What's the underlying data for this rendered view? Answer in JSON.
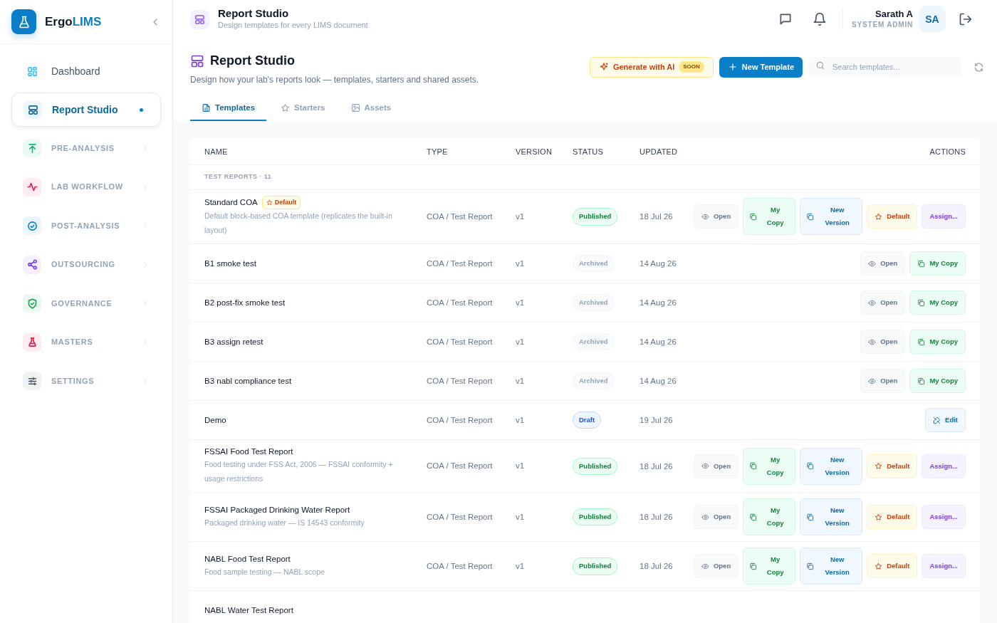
{
  "brand": {
    "prefix": "Ergo",
    "suffix": "LIMS"
  },
  "sidebar": {
    "items": [
      {
        "label": "Dashboard",
        "kind": "link",
        "selected": false
      },
      {
        "label": "Report Studio",
        "kind": "link",
        "selected": true
      },
      {
        "label": "PRE-ANALYSIS",
        "kind": "section",
        "selected": false,
        "color": "#10b981"
      },
      {
        "label": "LAB WORKFLOW",
        "kind": "section",
        "selected": false,
        "color": "#e11d48"
      },
      {
        "label": "POST-ANALYSIS",
        "kind": "section",
        "selected": false,
        "color": "#0284c7"
      },
      {
        "label": "OUTSOURCING",
        "kind": "section",
        "selected": false,
        "color": "#7c3aed"
      },
      {
        "label": "GOVERNANCE",
        "kind": "section",
        "selected": false,
        "color": "#16a34a"
      },
      {
        "label": "MASTERS",
        "kind": "section",
        "selected": false,
        "color": "#e11d48"
      },
      {
        "label": "SETTINGS",
        "kind": "section",
        "selected": false,
        "color": "#475569"
      }
    ]
  },
  "topbar": {
    "title": "Report Studio",
    "subtitle": "Design templates for every LIMS document",
    "user": {
      "name": "Sarath A",
      "role": "SYSTEM ADMIN",
      "initials": "SA"
    }
  },
  "page": {
    "title": "Report Studio",
    "description": "Design how your lab's reports look — templates, starters and shared assets.",
    "ai_button": {
      "label": "Generate with AI",
      "badge": "SOON"
    },
    "new_button": "New Template",
    "search": {
      "placeholder": "Search templates..."
    }
  },
  "tabs": [
    {
      "label": "Templates",
      "selected": true
    },
    {
      "label": "Starters",
      "selected": false
    },
    {
      "label": "Assets",
      "selected": false
    }
  ],
  "table": {
    "columns": [
      "NAME",
      "TYPE",
      "VERSION",
      "STATUS",
      "UPDATED",
      "ACTIONS"
    ],
    "group": "TEST REPORTS · 11",
    "rows": [
      {
        "name": "Standard COA",
        "badge": "Default",
        "description": "Default block-based COA template (replicates the built-in layout)",
        "type": "COA / Test Report",
        "version": "v1",
        "status": {
          "label": "Published",
          "kind": "published"
        },
        "updated": "18 Jul 26",
        "actions": [
          {
            "label": "Open",
            "kind": "open"
          },
          {
            "label": "My Copy",
            "kind": "copy"
          },
          {
            "label": "New Version",
            "kind": "version"
          },
          {
            "label": "Default",
            "kind": "default"
          },
          {
            "label": "Assign...",
            "kind": "assign"
          }
        ]
      },
      {
        "name": "B1 smoke test",
        "type": "COA / Test Report",
        "version": "v1",
        "status": {
          "label": "Archived",
          "kind": "archived"
        },
        "updated": "14 Aug 26",
        "actions": [
          {
            "label": "Open",
            "kind": "open"
          },
          {
            "label": "My Copy",
            "kind": "copy"
          }
        ]
      },
      {
        "name": "B2 post-fix smoke test",
        "type": "COA / Test Report",
        "version": "v1",
        "status": {
          "label": "Archived",
          "kind": "archived"
        },
        "updated": "14 Aug 26",
        "actions": [
          {
            "label": "Open",
            "kind": "open"
          },
          {
            "label": "My Copy",
            "kind": "copy"
          }
        ]
      },
      {
        "name": "B3 assign retest",
        "type": "COA / Test Report",
        "version": "v1",
        "status": {
          "label": "Archived",
          "kind": "archived"
        },
        "updated": "14 Aug 26",
        "actions": [
          {
            "label": "Open",
            "kind": "open"
          },
          {
            "label": "My Copy",
            "kind": "copy"
          }
        ]
      },
      {
        "name": "B3 nabl compliance test",
        "type": "COA / Test Report",
        "version": "v1",
        "status": {
          "label": "Archived",
          "kind": "archived"
        },
        "updated": "14 Aug 26",
        "actions": [
          {
            "label": "Open",
            "kind": "open"
          },
          {
            "label": "My Copy",
            "kind": "copy"
          }
        ]
      },
      {
        "name": "Demo",
        "type": "COA / Test Report",
        "version": "v1",
        "status": {
          "label": "Draft",
          "kind": "draft"
        },
        "updated": "19 Jul 26",
        "actions": [
          {
            "label": "Edit",
            "kind": "edit"
          }
        ]
      },
      {
        "name": "FSSAI Food Test Report",
        "description": "Food testing under FSS Act, 2006 — FSSAI conformity + usage restrictions",
        "type": "COA / Test Report",
        "version": "v1",
        "status": {
          "label": "Published",
          "kind": "published"
        },
        "updated": "18 Jul 26",
        "actions": [
          {
            "label": "Open",
            "kind": "open"
          },
          {
            "label": "My Copy",
            "kind": "copy"
          },
          {
            "label": "New Version",
            "kind": "version"
          },
          {
            "label": "Default",
            "kind": "default"
          },
          {
            "label": "Assign...",
            "kind": "assign"
          }
        ]
      },
      {
        "name": "FSSAI Packaged Drinking Water Report",
        "description": "Packaged drinking water — IS 14543 conformity",
        "type": "COA / Test Report",
        "version": "v1",
        "status": {
          "label": "Published",
          "kind": "published"
        },
        "updated": "18 Jul 26",
        "actions": [
          {
            "label": "Open",
            "kind": "open"
          },
          {
            "label": "My Copy",
            "kind": "copy"
          },
          {
            "label": "New Version",
            "kind": "version"
          },
          {
            "label": "Default",
            "kind": "default"
          },
          {
            "label": "Assign...",
            "kind": "assign"
          }
        ]
      },
      {
        "name": "NABL Food Test Report",
        "description": "Food sample testing — NABL scope",
        "type": "COA / Test Report",
        "version": "v1",
        "status": {
          "label": "Published",
          "kind": "published"
        },
        "updated": "18 Jul 26",
        "actions": [
          {
            "label": "Open",
            "kind": "open"
          },
          {
            "label": "My Copy",
            "kind": "copy"
          },
          {
            "label": "New Version",
            "kind": "version"
          },
          {
            "label": "Default",
            "kind": "default"
          },
          {
            "label": "Assign...",
            "kind": "assign"
          }
        ]
      },
      {
        "name": "NABL Water Test Report"
      }
    ]
  }
}
